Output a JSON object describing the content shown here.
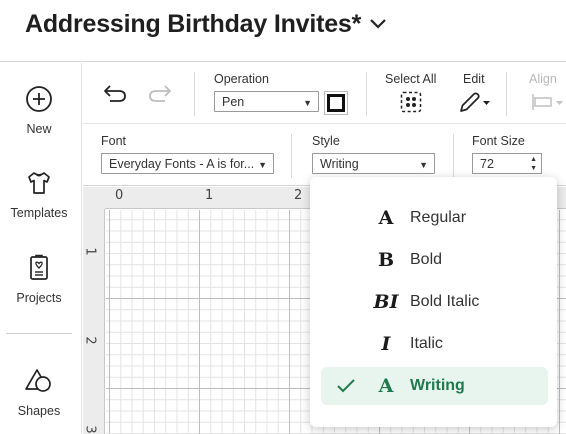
{
  "header": {
    "title": "Addressing Birthday Invites*"
  },
  "sidebar": {
    "items": [
      {
        "label": "New",
        "icon": "plus-circle-icon"
      },
      {
        "label": "Templates",
        "icon": "tshirt-icon"
      },
      {
        "label": "Projects",
        "icon": "projects-icon"
      },
      {
        "label": "Shapes",
        "icon": "shapes-icon"
      }
    ]
  },
  "toolbar": {
    "operation_label": "Operation",
    "operation_value": "Pen",
    "select_all_label": "Select All",
    "edit_label": "Edit",
    "align_label": "Align"
  },
  "text_toolbar": {
    "font_label": "Font",
    "font_value": "Everyday Fonts - A is for...",
    "style_label": "Style",
    "style_value": "Writing",
    "font_size_label": "Font Size",
    "font_size_value": "72"
  },
  "rulers": {
    "top": [
      "0",
      "1",
      "2"
    ],
    "left": [
      "1",
      "2",
      "3"
    ]
  },
  "style_menu": {
    "items": [
      {
        "glyph": "A",
        "label": "Regular",
        "selected": false
      },
      {
        "glyph": "B",
        "label": "Bold",
        "selected": false
      },
      {
        "glyph": "BI",
        "label": "Bold Italic",
        "selected": false
      },
      {
        "glyph": "I",
        "label": "Italic",
        "selected": false
      },
      {
        "glyph": "A",
        "label": "Writing",
        "selected": true
      }
    ]
  },
  "colors": {
    "accent": "#1f7a4d",
    "selected_bg": "#e8f4ee",
    "pen_color": "#111111"
  }
}
